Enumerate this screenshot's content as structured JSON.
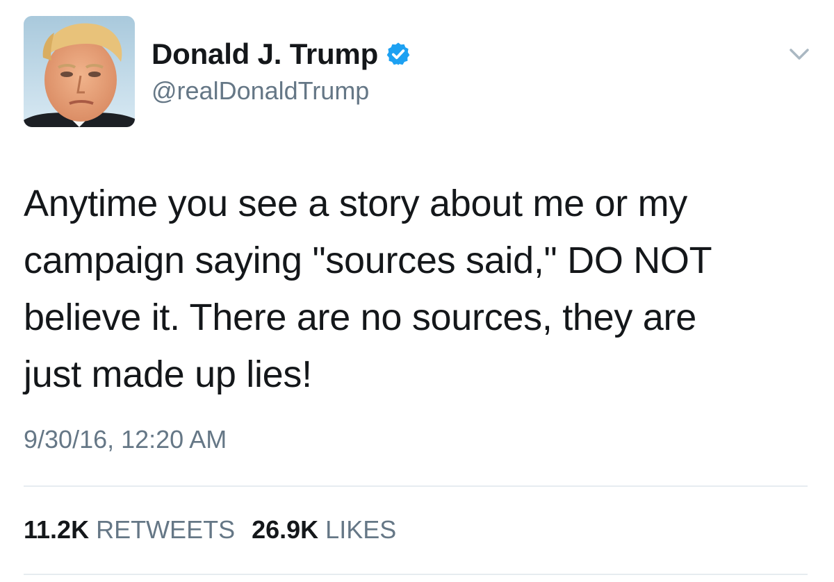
{
  "author": {
    "name": "Donald J. Trump",
    "handle": "@realDonaldTrump",
    "verified": true,
    "avatar_icon": "profile-photo"
  },
  "tweet": {
    "text": "Anytime you see a story about me or my\ncampaign saying \"sources said,\" DO NOT\nbelieve it. There are no sources, they are\njust made up lies!",
    "timestamp": "9/30/16, 12:20 AM"
  },
  "stats": {
    "retweets_count": "11.2K",
    "retweets_label": "RETWEETS",
    "likes_count": "26.9K",
    "likes_label": "LIKES"
  },
  "icons": {
    "verified": "verified-badge-icon",
    "caret": "chevron-down-icon"
  },
  "colors": {
    "verified_blue": "#1da1f2",
    "secondary_text": "#657786",
    "primary_text": "#14171a",
    "divider": "#e6ecf0"
  }
}
